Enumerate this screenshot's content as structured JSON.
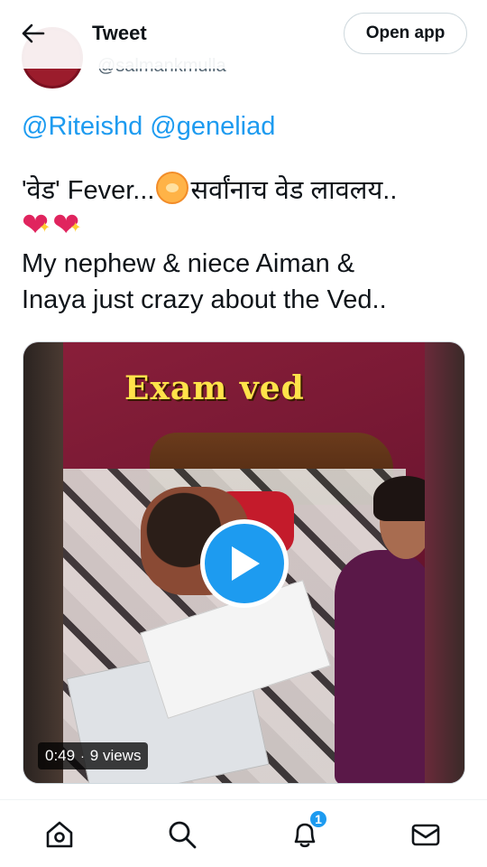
{
  "header": {
    "title": "Tweet",
    "open_app_label": "Open app"
  },
  "author": {
    "handle": "@salmankmulla"
  },
  "tweet": {
    "mentions": [
      "@Riteishd",
      "@geneliad"
    ],
    "line_1_prefix": "'वेड' Fever...",
    "line_1_suffix": "सर्वांनाच वेड लावलय..",
    "line_3": "My nephew & niece Aiman &",
    "line_4": "Inaya just crazy about the Ved.."
  },
  "video": {
    "caption": "Exam ved",
    "duration": "0:49",
    "views": "9 views"
  },
  "nav": {
    "notifications_badge": "1",
    "icons": [
      "home-icon",
      "search-icon",
      "bell-icon",
      "mail-icon"
    ]
  },
  "colors": {
    "accent": "#1d9bf0",
    "text": "#0f1419",
    "muted": "#536471"
  }
}
